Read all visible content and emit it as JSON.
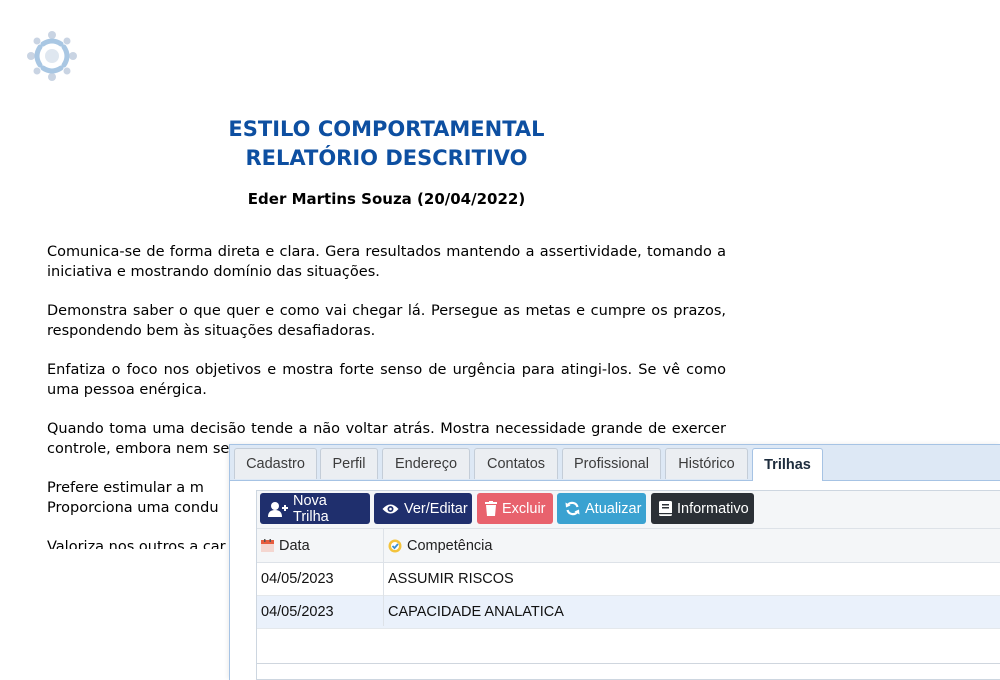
{
  "report": {
    "title_line1": "ESTILO COMPORTAMENTAL",
    "title_line2": "RELATÓRIO DESCRITIVO",
    "subject": "Eder Martins Souza (20/04/2022)",
    "paragraphs": [
      "Comunica-se de forma direta e clara. Gera resultados mantendo a assertividade, tomando a iniciativa e mostrando domínio das situações.",
      "Demonstra saber o que quer e como vai chegar lá. Persegue as metas e cumpre os prazos, respondendo bem às situações desafiadoras.",
      "Enfatiza o foco nos objetivos e mostra forte senso de urgência para atingi-los. Se vê como uma pessoa enérgica.",
      "Quando toma uma decisão tende a não voltar atrás. Mostra necessidade grande de exercer controle, embora nem se",
      "Prefere estimular a m",
      "Proporciona uma condu",
      "Valoriza nos outros a car"
    ]
  },
  "tabs": [
    "Cadastro",
    "Perfil",
    "Endereço",
    "Contatos",
    "Profissional",
    "Histórico",
    "Trilhas"
  ],
  "active_tab": "Trilhas",
  "toolbar": {
    "new_label": "Nova Trilha",
    "view_label": "Ver/Editar",
    "delete_label": "Excluir",
    "refresh_label": "Atualizar",
    "info_label": "Informativo"
  },
  "grid": {
    "columns": [
      "Data",
      "Competência"
    ],
    "rows": [
      {
        "date": "04/05/2023",
        "competence": "ASSUMIR RISCOS"
      },
      {
        "date": "04/05/2023",
        "competence": "CAPACIDADE ANALATICA"
      }
    ]
  },
  "colors": {
    "title_blue": "#0d4fa1",
    "navy_button": "#1f2f6d",
    "red_button": "#e8626d",
    "sky_button": "#3aa2d1",
    "dark_button": "#2b3036",
    "selected_row": "#eaf1fb"
  }
}
